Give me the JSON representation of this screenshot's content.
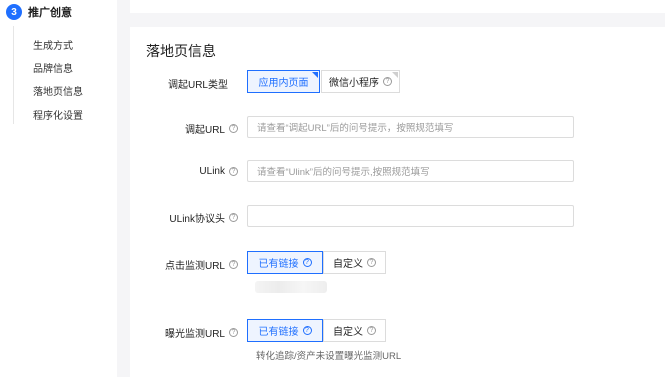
{
  "sidebar": {
    "step_number": "3",
    "step_title": "推广创意",
    "items": [
      {
        "label": "生成方式"
      },
      {
        "label": "品牌信息"
      },
      {
        "label": "落地页信息"
      },
      {
        "label": "程序化设置"
      }
    ]
  },
  "section": {
    "title": "落地页信息"
  },
  "form": {
    "url_type": {
      "label": "调起URL类型",
      "options": [
        {
          "label": "应用内页面",
          "selected": true
        },
        {
          "label": "微信小程序",
          "selected": false
        }
      ]
    },
    "invoke_url": {
      "label": "调起URL",
      "placeholder": "请查看“调起URL”后的问号提示，按照规范填写"
    },
    "ulink": {
      "label": "ULink",
      "placeholder": "请查看“Ulink”后的问号提示,按照规范填写"
    },
    "ulink_protocol": {
      "label": "ULink协议头",
      "placeholder": ""
    },
    "click_monitor": {
      "label": "点击监测URL",
      "options": [
        {
          "label": "已有链接",
          "selected": true
        },
        {
          "label": "自定义",
          "selected": false
        }
      ]
    },
    "impression_monitor": {
      "label": "曝光监测URL",
      "options": [
        {
          "label": "已有链接",
          "selected": true
        },
        {
          "label": "自定义",
          "selected": false
        }
      ],
      "hint": "转化追踪/资产未设置曝光监测URL"
    }
  },
  "icons": {
    "help": "?",
    "corner": "corner-marker"
  },
  "colors": {
    "accent": "#1f6fff",
    "accent_bg": "#eef4ff",
    "border": "#dcdcdc",
    "page_bg": "#f5f5f7"
  }
}
